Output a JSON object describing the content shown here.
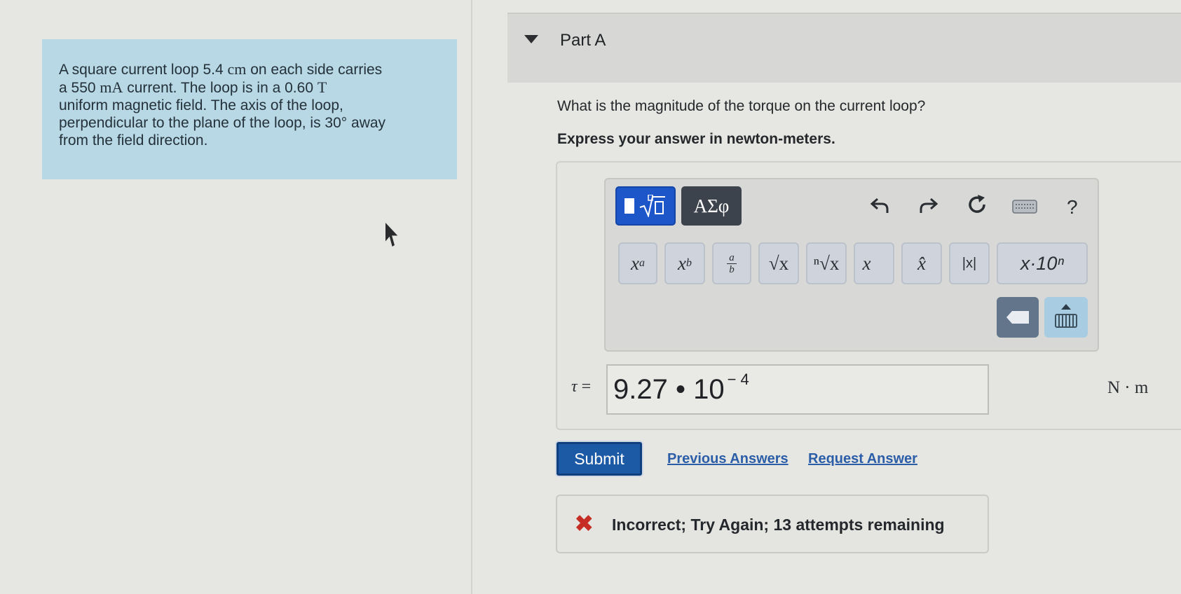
{
  "problem": {
    "line1_pre": "A square current loop 5.4 ",
    "unit_cm": "cm",
    "line1_post": " on each side carries",
    "line2_pre": "a 550 ",
    "unit_ma": "mA",
    "line2_mid": " current. The loop is in a 0.60 ",
    "unit_t": "T",
    "line3": "uniform magnetic field. The axis of the loop,",
    "line4": "perpendicular to the plane of the loop, is 30° away",
    "line5": "from the field direction."
  },
  "part": {
    "title": "Part A"
  },
  "question": "What is the magnitude of the torque on the current loop?",
  "instruction": "Express your answer in newton-meters.",
  "toolbar": {
    "greek_label": "ΑΣφ",
    "help_label": "?",
    "keys": [
      {
        "base": "x",
        "sup": "a",
        "sub": ""
      },
      {
        "base": "x",
        "sup": "",
        "sub": "b"
      },
      {
        "frac_num": "a",
        "frac_den": "b"
      },
      {
        "label": "√x"
      },
      {
        "label": "ⁿ√x"
      },
      {
        "label": "x⃗"
      },
      {
        "label": "x̂"
      },
      {
        "label": "|x|"
      },
      {
        "label": "x·10ⁿ"
      }
    ]
  },
  "answer": {
    "variable": "τ",
    "equals": "=",
    "mantissa": "9.27 • 10",
    "exponent": "− 4",
    "units": "N · m"
  },
  "actions": {
    "submit": "Submit",
    "previous_answers": "Previous Answers",
    "request_answer": "Request Answer"
  },
  "feedback": {
    "status": "incorrect",
    "message": "Incorrect; Try Again; 13 attempts remaining"
  },
  "colors": {
    "problem_bg": "#b7d8e4",
    "submit_bg": "#1c5aa6",
    "template_btn": "#1c56c8",
    "error_red": "#c62d24",
    "link": "#2c5ea8"
  }
}
